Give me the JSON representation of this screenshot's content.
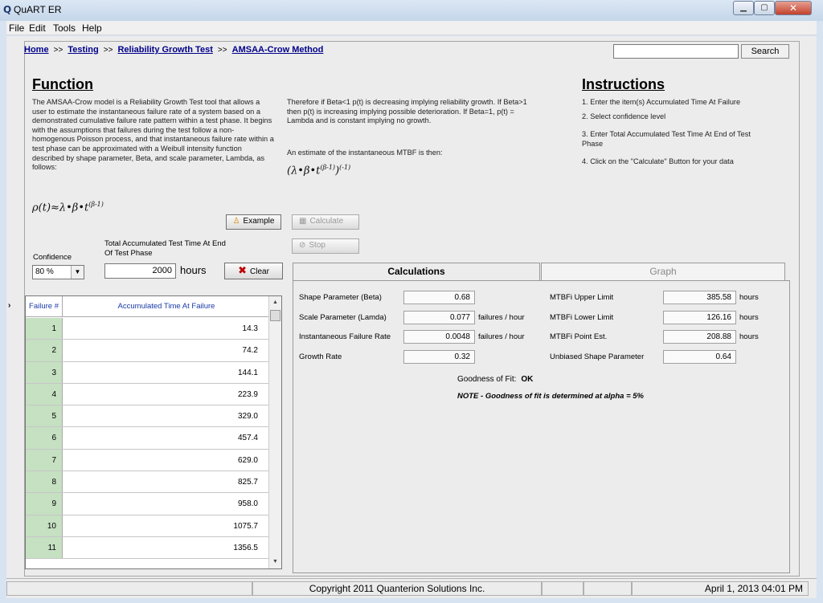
{
  "window": {
    "title": "QuART ER",
    "icon": "Q",
    "controls": {
      "minimize": "minimize-icon",
      "maximize": "maximize-icon",
      "close": "close-icon"
    }
  },
  "menu": [
    "File",
    "Edit",
    "Tools",
    "Help"
  ],
  "breadcrumb": {
    "items": [
      "Home",
      "Testing",
      "Reliability Growth Test",
      "AMSAA-Crow Method"
    ],
    "separator": ">>"
  },
  "search": {
    "value": "",
    "button": "Search"
  },
  "function": {
    "title": "Function",
    "left_text": "The AMSAA-Crow model is a Reliability Growth Test tool that allows a user to estimate the instantaneous failure rate of a system based on a demonstrated cumulative failure rate pattern within a test phase. It begins with the assumptions that failures during the test follow a non-homogenous Poisson process, and that instantaneous failure rate within a test phase can be approximated with a Weibull intensity function described by shape parameter, Beta, and scale parameter, Lambda, as follows:",
    "right_text": "Therefore if Beta<1 p(t) is decreasing implying reliability growth. If Beta>1 then p(t) is increasing implying possible deterioration. If Beta=1, p(t) = Lambda  and is constant implying no growth.",
    "right_text_2": "An estimate of the instantaneous MTBF is then:",
    "formula_rho": "ρ(t)≈λ•β•t",
    "formula_rho_exp": "(β-1)",
    "formula_mtbf": "(λ•β•t",
    "formula_mtbf_exp": "(β-1)",
    "formula_mtbf_close": ")",
    "formula_mtbf_exp2": "(-1)"
  },
  "instructions": {
    "title": "Instructions",
    "steps": [
      "1. Enter the item(s) Accumulated Time At Failure",
      "2. Select confidence level",
      "3. Enter Total Accumulated Test Time At End of Test Phase",
      "4. Click on the \"Calculate\" Button for your data"
    ]
  },
  "buttons": {
    "example": "Example",
    "calculate": "Calculate",
    "stop": "Stop",
    "clear": "Clear"
  },
  "confidence": {
    "label": "Confidence",
    "value": "80 %"
  },
  "total_time": {
    "label": "Total Accumulated Test Time At End Of Test Phase",
    "value": "2000",
    "unit": "hours"
  },
  "table": {
    "headers": [
      "Failure #",
      "Accumulated Time At Failure"
    ],
    "rows": [
      [
        "1",
        "14.3"
      ],
      [
        "2",
        "74.2"
      ],
      [
        "3",
        "144.1"
      ],
      [
        "4",
        "223.9"
      ],
      [
        "5",
        "329.0"
      ],
      [
        "6",
        "457.4"
      ],
      [
        "7",
        "629.0"
      ],
      [
        "8",
        "825.7"
      ],
      [
        "9",
        "958.0"
      ],
      [
        "10",
        "1075.7"
      ],
      [
        "11",
        "1356.5"
      ]
    ]
  },
  "tabs": [
    "Calculations",
    "Graph"
  ],
  "results": {
    "left": [
      {
        "label": "Shape Parameter (Beta)",
        "value": "0.68",
        "unit": ""
      },
      {
        "label": "Scale Parameter (Lamda)",
        "value": "0.077",
        "unit": "failures / hour"
      },
      {
        "label": "Instantaneous Failure Rate",
        "value": "0.0048",
        "unit": "failures / hour"
      },
      {
        "label": "Growth Rate",
        "value": "0.32",
        "unit": ""
      }
    ],
    "right": [
      {
        "label": "MTBFi Upper Limit",
        "value": "385.58",
        "unit": "hours"
      },
      {
        "label": "MTBFi Lower Limit",
        "value": "126.16",
        "unit": "hours"
      },
      {
        "label": "MTBFi Point Est.",
        "value": "208.88",
        "unit": "hours"
      },
      {
        "label": "Unbiased Shape Parameter",
        "value": "0.64",
        "unit": ""
      }
    ],
    "goodness_label": "Goodness of Fit:",
    "goodness_value": "OK",
    "note": "NOTE - Goodness of fit is determined at alpha = 5%"
  },
  "status": {
    "copyright": "Copyright 2011 Quanterion Solutions Inc.",
    "datetime": "April 1, 2013  04:01 PM"
  }
}
